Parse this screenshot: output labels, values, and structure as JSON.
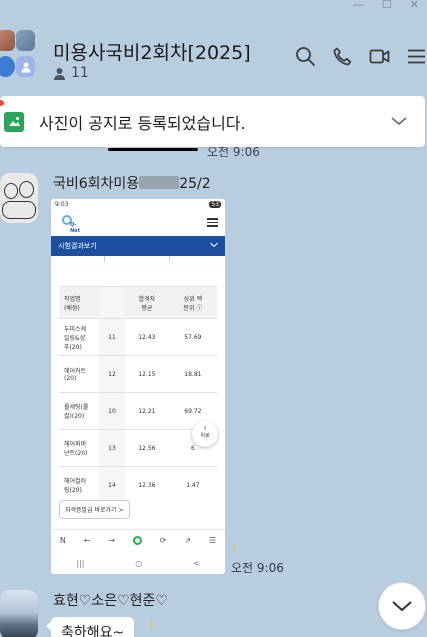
{
  "window": {
    "controls": [
      "—",
      "☐",
      "✕"
    ]
  },
  "header": {
    "title": "미용사국비2회차[2025]",
    "member_count": "11",
    "icons": [
      "search-icon",
      "phone-icon",
      "video-icon",
      "menu-icon"
    ]
  },
  "notice": {
    "text": "사진이 공지로 등록되었습니다.",
    "icon": "photo-notice-icon"
  },
  "peek": {
    "time": "오전 9:06"
  },
  "messages": [
    {
      "sender_prefix": "국비6회차미용",
      "sender_suffix": "25/2",
      "unread": "1",
      "time": "오전 9:06",
      "screenshot": {
        "status_time": "9:03",
        "battery": "53",
        "logo": "Q-Net",
        "section_title": "시험결과보기",
        "table": {
          "headers": [
            "작업명\n(배점)",
            "",
            "합격자\n평균",
            "상위 백\n분위 ⓘ"
          ],
          "rows": [
            [
              "두피스케\n일링&샴\n푸(20)",
              "11",
              "12.43",
              "57.69"
            ],
            [
              "헤어커트\n(20)",
              "12",
              "12.15",
              "18.81"
            ],
            [
              "롤세팅(롤\n컬)(20)",
              "10",
              "12.21",
              "69.72"
            ],
            [
              "헤어퍼머\n넌트(20)",
              "13",
              "12.56",
              "6"
            ],
            [
              "헤어컬러\n링(20)",
              "14",
              "12.36",
              "1.47"
            ]
          ]
        },
        "button": "자격증발급 바로가기 >",
        "up_button": "위로",
        "nav": [
          "N",
          "←",
          "→",
          "●",
          "⟳",
          "↗",
          "☰"
        ],
        "sys_nav": [
          "|||",
          "○",
          "<"
        ]
      }
    },
    {
      "sender": "효현♡소은♡현준♡",
      "text": "축하해요~",
      "unread": "1"
    }
  ],
  "colors": {
    "background": "#b9cde0",
    "bubble": "#ffffff",
    "unread": "#e5c54a",
    "notice_icon": "#2aa55a",
    "qnet_bar": "#1d4fa0"
  }
}
